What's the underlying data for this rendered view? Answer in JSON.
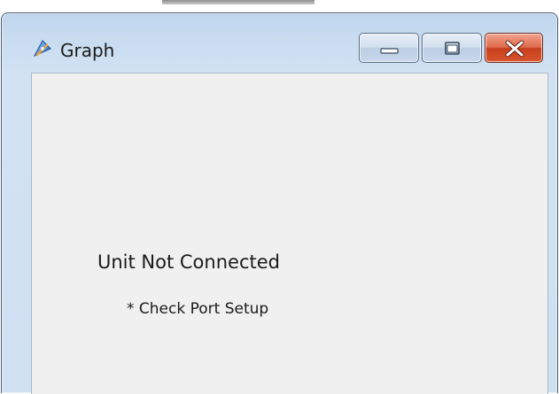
{
  "window": {
    "title": "Graph",
    "app_icon": "app-logo-icon",
    "controls": {
      "minimize_icon": "minimize-icon",
      "maximize_icon": "maximize-icon",
      "close_icon": "close-icon"
    }
  },
  "content": {
    "status_text": "Unit Not Connected",
    "hint_text": "* Check Port Setup"
  },
  "colors": {
    "titlebar": "#c9dcf0",
    "client_bg": "#f0f0f0",
    "close_button": "#d9532b"
  }
}
